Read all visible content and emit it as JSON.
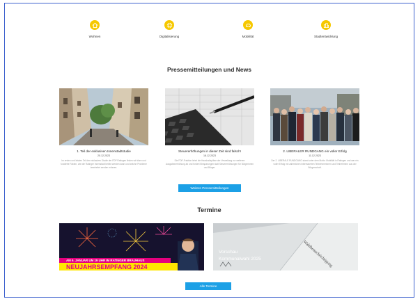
{
  "topics": [
    {
      "label": "Wohnen",
      "icon": "house-icon"
    },
    {
      "label": "Digitalisierung",
      "icon": "chip-icon"
    },
    {
      "label": "Mobilität",
      "icon": "car-icon"
    },
    {
      "label": "Stadtentwicklung",
      "icon": "city-icon"
    }
  ],
  "news": {
    "heading": "Pressemitteilungen und News",
    "cards": [
      {
        "title": "1. Teil der exklusiven Innenstadtstudie",
        "date": "20.12.2023",
        "excerpt": "Im ersten und letzten Teil der exklusiven Studie der FDP Ratingen finden wir klare und fundierte Fakten, wie die Ratinger Innenstadt belebt werden kann und welche Probleme bearbeitet werden müssen."
      },
      {
        "title": "Steuererhöhungen in dieser Zeit sind falsch!",
        "date": "18.12.2023",
        "excerpt": "Die FDP-Fraktion lehnt die Haushaltspläne der Verwaltung zur weiteren Ausgabenerhöhung ab und fordert Einsparungen statt Steuererhöhungen für Bürgerinnen und Bürger."
      },
      {
        "title": "2. LIBERALER RUNDGANG ein voller Erfolg",
        "date": "11.12.2023",
        "excerpt": "Der 2. LIBERALE RUNDGANG stand unter dem Motto: Mobilität in Ratingen und war ein voller Erfolg mit zahlreichen interessierten Teilnehmerinnen und Teilnehmern aus der Bürgerschaft."
      }
    ],
    "more_button": "Weitere Pressemitteilungen"
  },
  "events": {
    "heading": "Termine",
    "items": [
      {
        "banner_line": "AM 6. JANUAR UM 19 UHR IM RATINGER BRAUHAUS",
        "banner_big": "NEUJAHRSEMPFANG 2024"
      },
      {
        "title_line1": "Vorschau",
        "title_line2": "Kommunalwahl 2025",
        "paper_text": "Wahlbenachrichtigung"
      }
    ],
    "all_button": "Alle Termine"
  },
  "colors": {
    "accent": "#1ca0e6",
    "icon_yellow": "#f6c800",
    "border": "#3a5fcd"
  }
}
